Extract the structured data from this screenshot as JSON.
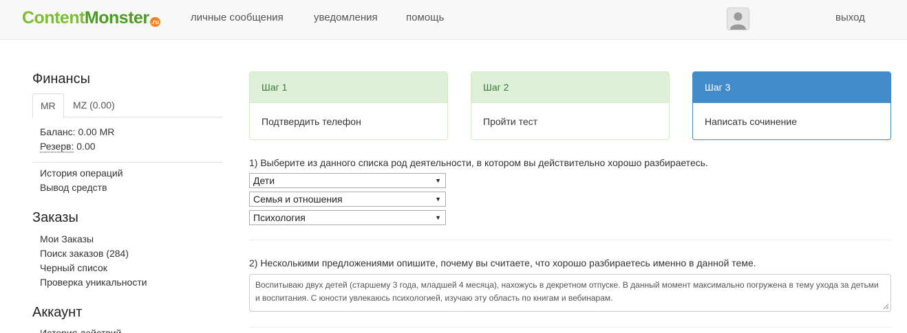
{
  "header": {
    "logo": {
      "part1": "Content",
      "part2": "Monster",
      "badge": ".ru"
    },
    "nav": [
      "личные сообщения",
      "уведомления",
      "помощь"
    ],
    "avatar_icon": "user-avatar-icon",
    "logout": "выход"
  },
  "sidebar": {
    "finance": {
      "title": "Финансы",
      "tabs": [
        "MR",
        "MZ (0.00)"
      ],
      "balance": "Баланс: 0.00 MR",
      "reserve_label": "Резерв:",
      "reserve_value": " 0.00",
      "links": [
        "История операций",
        "Вывод средств"
      ]
    },
    "orders": {
      "title": "Заказы",
      "links": [
        "Мои Заказы",
        "Поиск заказов (284)",
        "Черный список",
        "Проверка уникальности"
      ]
    },
    "account": {
      "title": "Аккаунт",
      "links": [
        "История действий"
      ]
    }
  },
  "steps": [
    {
      "title": "Шаг 1",
      "text": "Подтвердить телефон"
    },
    {
      "title": "Шаг 2",
      "text": "Пройти тест"
    },
    {
      "title": "Шаг 3",
      "text": "Написать сочинение"
    }
  ],
  "form": {
    "q1": "1) Выберите из данного списка род деятельности, в котором вы действительно хорошо разбираетесь.",
    "selects": [
      "Дети",
      "Семья и отношения",
      "Психология"
    ],
    "q2": "2) Несколькими предложениями опишите, почему вы считаете, что хорошо разбираетесь именно в данной теме.",
    "answer": "Воспитываю двух детей (старшему 3 года, младшей 4 месяца), нахожусь в декретном отпуске. В данный момент максимально погружена в тему ухода за детьми и воспитания. С юности увлекаюсь психологией, изучаю эту область по книгам и вебинарам."
  },
  "colors": {
    "step_done_bg": "#dff0d8",
    "step_done_text": "#3c763d",
    "step_active_bg": "#428bca",
    "logo_green_light": "#7cbf2e",
    "logo_green_dark": "#4b9d22",
    "logo_badge": "#f58220"
  }
}
